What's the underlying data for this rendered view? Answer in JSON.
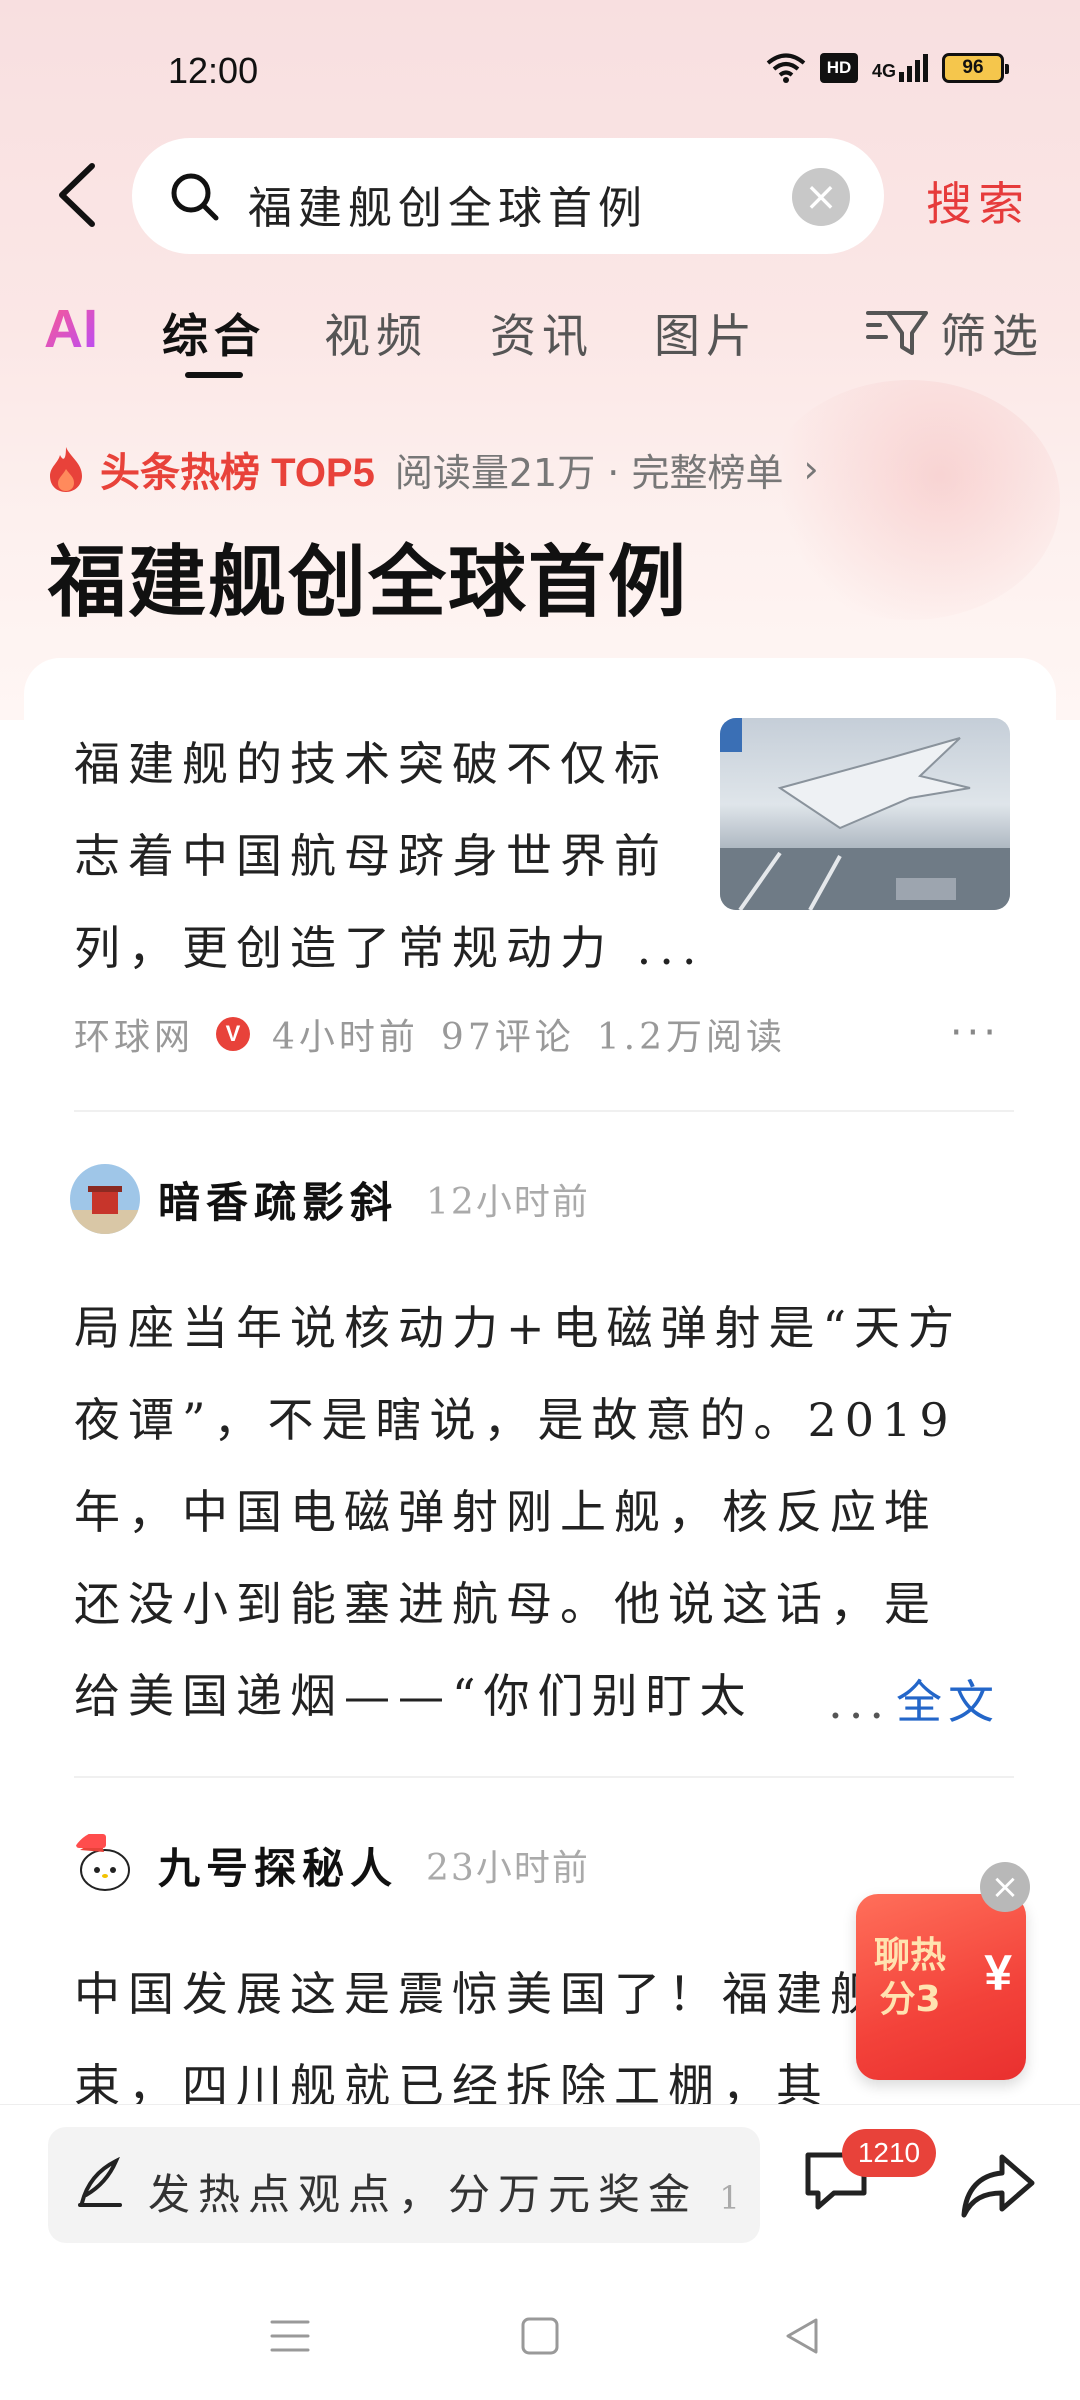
{
  "status_bar": {
    "time": "12:00",
    "hd_label": "HD",
    "network": "4G",
    "battery": "96",
    "icons": [
      "wifi-icon",
      "hd-icon",
      "signal-icon",
      "battery-icon"
    ]
  },
  "search": {
    "query": "福建舰创全球首例",
    "search_button": "搜索",
    "clear_icon": "×"
  },
  "tabs": {
    "ai_label": "AI",
    "items": [
      "综合",
      "视频",
      "资讯",
      "图片"
    ],
    "active": "综合",
    "filter_label": "筛选"
  },
  "hot": {
    "badge": "头条热榜 TOP5",
    "meta": "阅读量21万 · 完整榜单",
    "chevron": "›"
  },
  "page_title": "福建舰创全球首例",
  "article": {
    "text": "福建舰的技术突破不仅标志着中国航母跻身世界前列，更创造了常规动力 ...",
    "source": "环球网",
    "verified_badge": "V",
    "time": "4小时前",
    "comments": "97评论",
    "reads": "1.2万阅读",
    "more": "···"
  },
  "posts": [
    {
      "user": "暗香疏影斜",
      "time": "12小时前",
      "text": "局座当年说核动力+电磁弹射是“天方夜谭”，不是瞎说，是故意的。2019年，中国电磁弹射刚上舰，核反应堆还没小到能塞进航母。他说这话，是给美国递烟——“你们别盯太",
      "ellipsis": "...",
      "full_text_label": "全文"
    },
    {
      "user": "九号探秘人",
      "time": "23小时前",
      "text": "中国发展这是震惊美国了！福建舰没结束，四川舰就已经拆除工棚，其"
    }
  ],
  "promo": {
    "text": "聊热分3",
    "currency": "¥",
    "close": "×"
  },
  "bottom_bar": {
    "placeholder": "发热点观点，分万元奖金",
    "placeholder_tail": "1.",
    "comment_count": "1210"
  },
  "colors": {
    "accent": "#e8423a",
    "link": "#2366c9",
    "bg_top": "#f8dfe0"
  }
}
